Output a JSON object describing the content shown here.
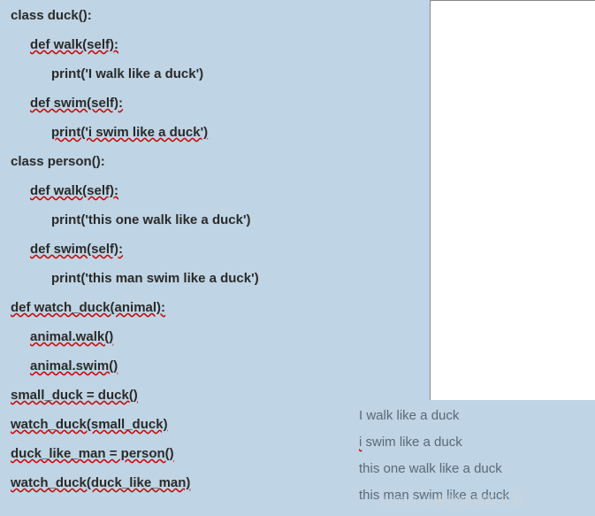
{
  "code": {
    "l1": "class duck():",
    "l2": "def walk(self):",
    "l3": "print('I walk like a duck')",
    "l4": "def swim(self):",
    "l5": "print('i swim like a duck')",
    "l6": "class person():",
    "l7": "def walk(self):",
    "l8": "print('this one walk like a duck')",
    "l9": "def swim(self):",
    "l10": "print('this man swim like a duck')",
    "l11": "def watch_duck(animal):",
    "l12": "animal.walk()",
    "l13": "animal.swim()",
    "l14": "small_duck = duck()",
    "l15": "watch_duck(small_duck)",
    "l16": "duck_like_man = person()",
    "l17": "watch_duck(duck_like_man)"
  },
  "output": {
    "o1": "I walk like a duck",
    "o2": "i swim like a duck",
    "o3": "this one walk like a duck",
    "o4": "this man swim like a duck"
  },
  "watermark": "CSDN @横明地哩斯芬客"
}
